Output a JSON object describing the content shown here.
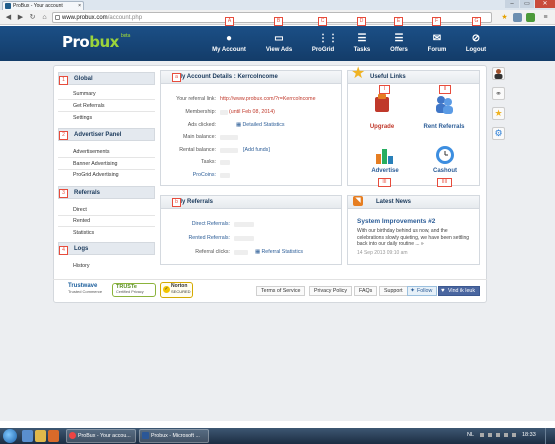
{
  "browser": {
    "tab_title": "ProBux - Your account",
    "tab_close": "×",
    "url_host": "www.probux.com",
    "url_path": "/account.php",
    "window_controls": [
      "–",
      "▭",
      "✕"
    ]
  },
  "site": {
    "logo_text": "Pro",
    "logo_text2": "bux",
    "logo_badge": "beta",
    "menu": [
      {
        "label": "My Account",
        "tag": "A",
        "icon": "user-icon"
      },
      {
        "label": "View Ads",
        "tag": "B",
        "icon": "monitor-icon"
      },
      {
        "label": "ProGrid",
        "tag": "C",
        "icon": "grid-icon"
      },
      {
        "label": "Tasks",
        "tag": "D",
        "icon": "list-icon"
      },
      {
        "label": "Offers",
        "tag": "E",
        "icon": "offers-icon"
      },
      {
        "label": "Forum",
        "tag": "F",
        "icon": "chat-icon"
      },
      {
        "label": "Logout",
        "tag": "G",
        "icon": "power-icon"
      }
    ]
  },
  "sidebar": {
    "sections": [
      {
        "title": "Global",
        "tag": "1",
        "items": [
          "Summary",
          "Get Referrals",
          "Settings"
        ]
      },
      {
        "title": "Advertiser Panel",
        "tag": "2",
        "items": [
          "Advertisements",
          "Banner Advertising",
          "ProGrid Advertising"
        ]
      },
      {
        "title": "Referrals",
        "tag": "3",
        "items": [
          "Direct",
          "Rented",
          "Statistics"
        ]
      },
      {
        "title": "Logs",
        "tag": "4",
        "items": [
          "History"
        ]
      }
    ]
  },
  "account": {
    "title": "My Account Details : Kerrcolncome",
    "tag": "a",
    "referral_link_label": "Your referral link:",
    "referral_link_value": "http://www.probux.com/?r=Kerrcolncome",
    "membership_label": "Membership:",
    "membership_value": "(until Feb 08, 2014)",
    "ads_clicked_label": "Ads clicked:",
    "ads_clicked_link": "Detailed Statistics",
    "main_balance_label": "Main balance:",
    "rental_balance_label": "Rental balance:",
    "rental_balance_link": "[Add funds]",
    "tasks_label": "Tasks:",
    "procoins_label": "ProCoins:"
  },
  "referrals": {
    "title": "My Referrals",
    "tag": "b",
    "direct_label": "Direct Referrals:",
    "rented_label": "Rented Referrals:",
    "clicks_label": "Referral clicks:",
    "clicks_link": "Referral Statistics"
  },
  "useful_links": {
    "title": "Useful Links",
    "items": [
      {
        "label": "Upgrade",
        "tag": "I",
        "icon": "upgrade-icon"
      },
      {
        "label": "Rent Referrals",
        "tag": "II",
        "icon": "rent-referrals-icon"
      },
      {
        "label": "Advertise",
        "tag": "III",
        "icon": "advertise-icon"
      },
      {
        "label": "Cashout",
        "tag": "IIII",
        "icon": "cashout-icon"
      }
    ]
  },
  "news": {
    "title": "Latest News",
    "headline": "System Improvements #2",
    "body": "With our birthday behind us now, and the celebrations slowly quieting, we have been settling back into our daily routine ... »",
    "date": "14 Sep 2013 09:10 am"
  },
  "footer": {
    "trust1": "Trustwave",
    "trust1_sub": "Trusted Commerce",
    "trust2": "TRUSTe",
    "trust2_sub": "Certified Privacy",
    "trust3": "Norton",
    "trust3_sub": "SECURED",
    "links": [
      "Terms of Service",
      "Privacy Policy",
      "FAQs",
      "Support"
    ],
    "follow": "Follow",
    "like": "Vind ik leuk"
  },
  "taskbar": {
    "buttons": [
      "ProBux - Your accou...",
      "Probux - Microsoft ..."
    ],
    "lang": "NL",
    "clock": "18:33"
  },
  "colors": {
    "header": "#1b4f86",
    "accent_green": "#9bd43b",
    "tag_red": "#e74c3c",
    "link_blue": "#2c5d97"
  }
}
